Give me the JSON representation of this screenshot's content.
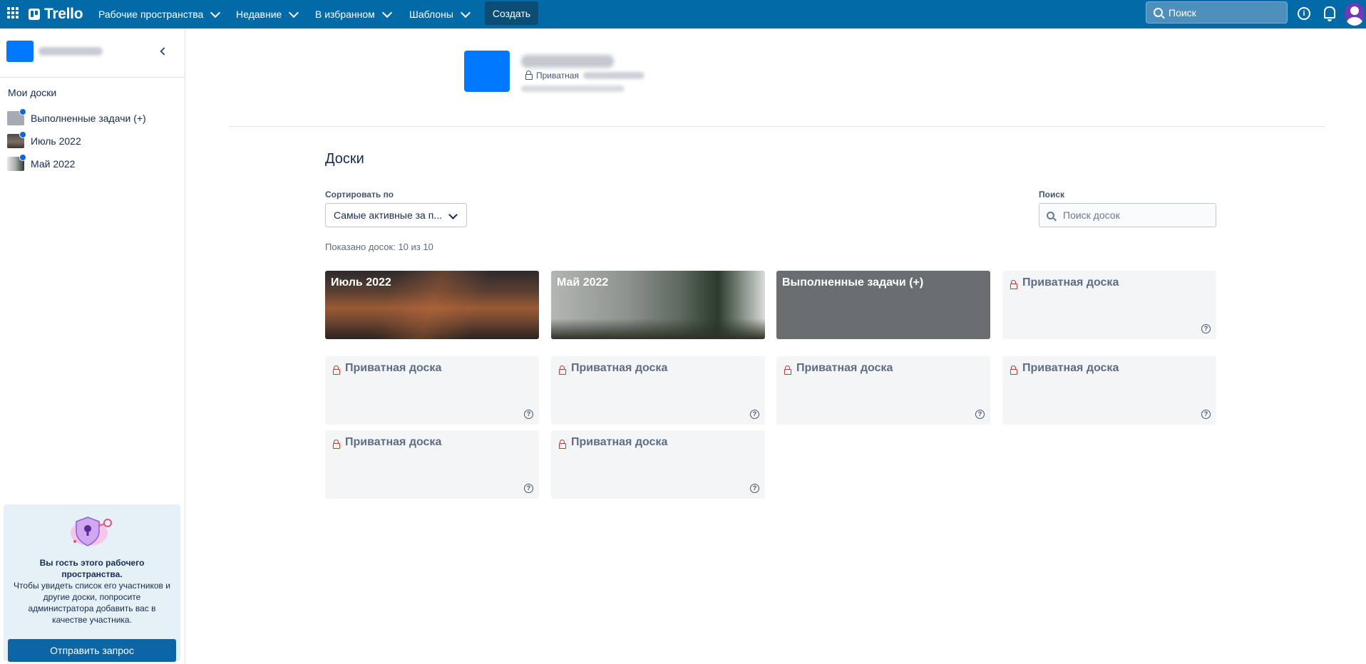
{
  "topbar": {
    "logo": "Trello",
    "nav": [
      {
        "label": "Рабочие пространства"
      },
      {
        "label": "Недавние"
      },
      {
        "label": "В избранном"
      },
      {
        "label": "Шаблоны"
      }
    ],
    "create_label": "Создать",
    "search_placeholder": "Поиск"
  },
  "sidebar": {
    "my_boards_title": "Мои доски",
    "boards": [
      {
        "label": "Выполненные задачи (+)"
      },
      {
        "label": "Июль 2022"
      },
      {
        "label": "Май 2022"
      }
    ],
    "guest": {
      "title": "Вы гость этого рабочего пространства.",
      "body": "Чтобы увидеть список его участников и другие доски, попросите администратора добавить вас в качестве участника.",
      "button": "Отправить запрос"
    }
  },
  "workspace": {
    "privacy": "Приватная"
  },
  "boards_section": {
    "title": "Доски",
    "sort_label": "Сортировать по",
    "sort_value": "Самые активные за п...",
    "search_label": "Поиск",
    "search_placeholder": "Поиск досок",
    "shown_count": "Показано досок: 10 из 10",
    "tiles": [
      {
        "title": "Июль 2022",
        "kind": "image"
      },
      {
        "title": "Май 2022",
        "kind": "image"
      },
      {
        "title": "Выполненные задачи (+)",
        "kind": "color"
      },
      {
        "title": "Приватная доска",
        "kind": "private"
      },
      {
        "title": "Приватная доска",
        "kind": "private"
      },
      {
        "title": "Приватная доска",
        "kind": "private"
      },
      {
        "title": "Приватная доска",
        "kind": "private"
      },
      {
        "title": "Приватная доска",
        "kind": "private"
      },
      {
        "title": "Приватная доска",
        "kind": "private"
      },
      {
        "title": "Приватная доска",
        "kind": "private"
      }
    ]
  },
  "colors": {
    "topbar": "#026aa7",
    "create_button": "#0c4d75",
    "send_button": "#0c66a6",
    "private_lock": "#c9372c"
  }
}
